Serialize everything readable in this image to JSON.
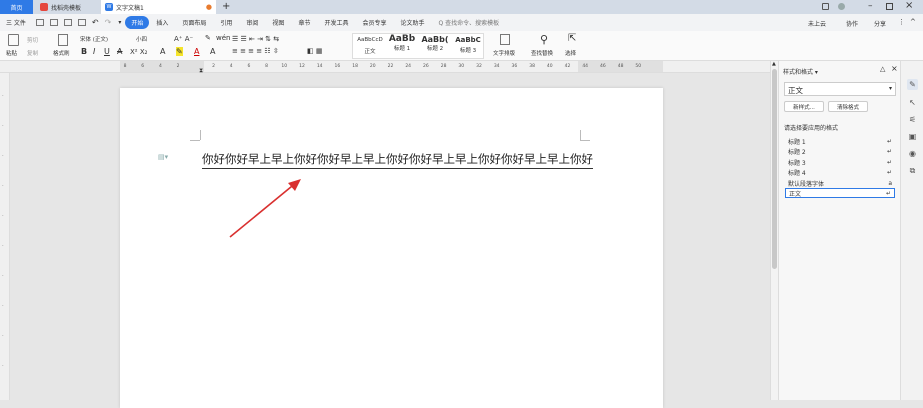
{
  "titlebar": {
    "tabs": [
      {
        "label": "首页"
      },
      {
        "label": "找稻壳模板"
      },
      {
        "label": "文字文稿1"
      }
    ],
    "add_tab": "+"
  },
  "menubar": {
    "file": "三 文件",
    "items": [
      "开始",
      "插入",
      "页面布局",
      "引用",
      "审阅",
      "视图",
      "章节",
      "开发工具",
      "会员专享",
      "论文助手"
    ],
    "search": "Q 查找命令、搜索模板",
    "right": [
      "未上云",
      "协作",
      "分享"
    ]
  },
  "ribbon": {
    "paste": "粘贴",
    "cut": "剪切",
    "copy": "复制",
    "format_painter": "格式刷",
    "font_name": "宋体 (正文)",
    "font_size": "小四",
    "styles": [
      {
        "preview": "AaBbCcD",
        "label": "正文"
      },
      {
        "preview": "AaBb",
        "label": "标题 1"
      },
      {
        "preview": "AaBb(",
        "label": "标题 2"
      },
      {
        "preview": "AaBbC",
        "label": "标题 3"
      }
    ],
    "text_layout": "文字排版",
    "find_replace": "查找替换",
    "select": "选择"
  },
  "ruler": {
    "ticks": [
      "8",
      "6",
      "4",
      "2",
      "",
      "2",
      "4",
      "6",
      "8",
      "10",
      "12",
      "14",
      "16",
      "18",
      "20",
      "22",
      "24",
      "26",
      "28",
      "30",
      "32",
      "34",
      "36",
      "38",
      "40",
      "42",
      "44",
      "46",
      "48",
      "50"
    ]
  },
  "document": {
    "text": "你好你好早上早上你好你好早上早上你好你好早上早上你好你好早上早上你好"
  },
  "panel": {
    "title": "样式和格式 ▾",
    "current_style": "正文",
    "new_style": "新样式...",
    "clear_format": "清除格式",
    "prompt": "请选择要应用的格式",
    "styles": [
      "标题 1",
      "标题 2",
      "标题 3",
      "标题 4",
      "默认段落字体",
      "正文"
    ]
  },
  "colors": {
    "accent": "#2f7ae6",
    "annotation_arrow": "#d9302f"
  }
}
